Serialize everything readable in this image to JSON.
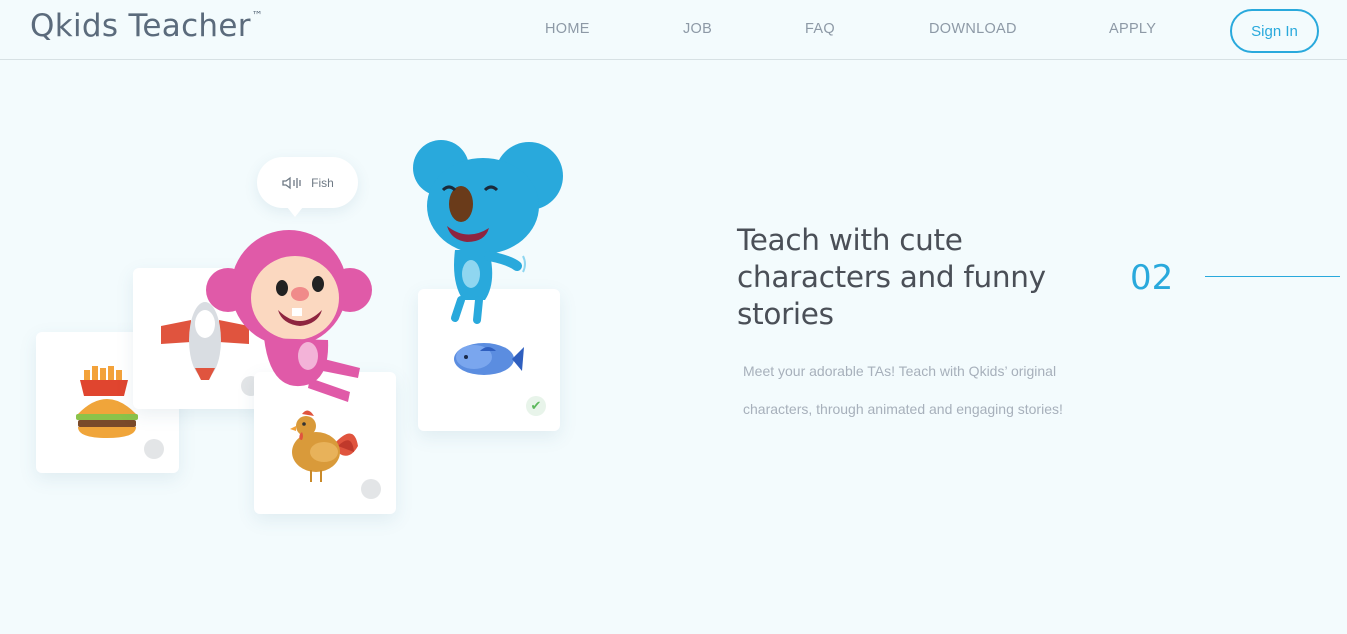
{
  "header": {
    "logo": "Qkids Teacher",
    "logo_tm": "™",
    "nav": [
      "HOME",
      "JOB",
      "FAQ",
      "DOWNLOAD",
      "APPLY"
    ],
    "signin_label": "Sign In"
  },
  "illustration": {
    "bubble_text": "Fish"
  },
  "feature": {
    "headline_lines": [
      "Teach with cute",
      "characters and funny",
      "stories"
    ],
    "number": "02",
    "desc_lines": [
      "Meet your adorable TAs! Teach with Qkids’ original",
      "characters, through animated and engaging stories!"
    ]
  },
  "colors": {
    "accent": "#29a9dc",
    "background": "#f3fbfd",
    "heading": "#4a4f57",
    "muted": "#a7b0bb"
  }
}
